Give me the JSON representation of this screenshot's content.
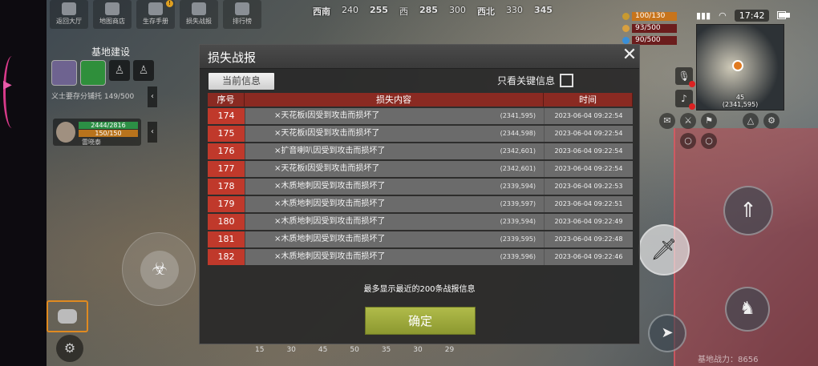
{
  "topnav": {
    "items": [
      {
        "label": "返回大厅",
        "icon": "home-icon"
      },
      {
        "label": "地图商店",
        "icon": "shop-icon"
      },
      {
        "label": "生存手册",
        "icon": "book-icon",
        "badge": "!"
      },
      {
        "label": "损失战报",
        "icon": "report-icon"
      },
      {
        "label": "排行榜",
        "icon": "ranking-icon"
      }
    ]
  },
  "compass": [
    "西南",
    "240",
    "255",
    "西",
    "285",
    "300",
    "西北",
    "330",
    "345"
  ],
  "stats": {
    "health": "100/130",
    "hunger": "93/500",
    "water": "90/500"
  },
  "status": {
    "time": "17:42"
  },
  "minimap": {
    "coords_line1": "45",
    "coords_line2": "(2341,595)"
  },
  "base": {
    "title": "基地建设",
    "line": "义士要存分铺托 149/500"
  },
  "vehicle": {
    "hp": "2444/2816",
    "fuel": "150/150",
    "name": "雷晓泰"
  },
  "right_hud": {
    "power_label": "基地战力：8656"
  },
  "modal": {
    "title": "损失战报",
    "tab_current": "当前信息",
    "filter_label": "只看关键信息",
    "columns": [
      "序号",
      "损失内容",
      "时间"
    ],
    "rows": [
      {
        "num": "174",
        "text": "×天花板I因受到攻击而损坏了",
        "coord": "(2341,595)",
        "time": "2023-06-04 09:22:54"
      },
      {
        "num": "175",
        "text": "×天花板I因受到攻击而损坏了",
        "coord": "(2344,598)",
        "time": "2023-06-04 09:22:54"
      },
      {
        "num": "176",
        "text": "×扩音喇叭因受到攻击而损坏了",
        "coord": "(2342,601)",
        "time": "2023-06-04 09:22:54"
      },
      {
        "num": "177",
        "text": "×天花板I因受到攻击而损坏了",
        "coord": "(2342,601)",
        "time": "2023-06-04 09:22:54"
      },
      {
        "num": "178",
        "text": "×木质地刺因受到攻击而损坏了",
        "coord": "(2339,594)",
        "time": "2023-06-04 09:22:53"
      },
      {
        "num": "179",
        "text": "×木质地刺因受到攻击而损坏了",
        "coord": "(2339,597)",
        "time": "2023-06-04 09:22:51"
      },
      {
        "num": "180",
        "text": "×木质地刺因受到攻击而损坏了",
        "coord": "(2339,594)",
        "time": "2023-06-04 09:22:49"
      },
      {
        "num": "181",
        "text": "×木质地刺因受到攻击而损坏了",
        "coord": "(2339,595)",
        "time": "2023-06-04 09:22:48"
      },
      {
        "num": "182",
        "text": "×木质地刺因受到攻击而损坏了",
        "coord": "(2339,596)",
        "time": "2023-06-04 09:22:46"
      }
    ],
    "footer_note": "最多显示最近的200条战报信息",
    "confirm_label": "确定"
  },
  "bottom_bar": [
    "15",
    "30",
    "45",
    "50",
    "35",
    "30",
    "29"
  ]
}
